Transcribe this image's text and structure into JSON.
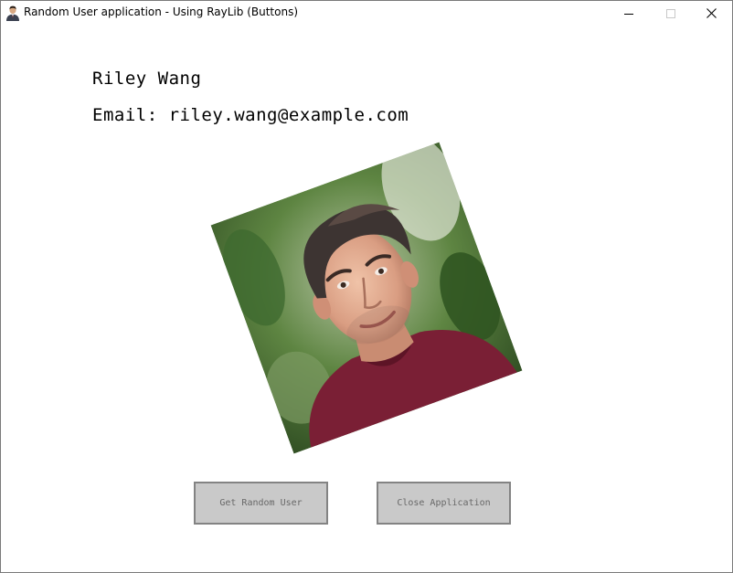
{
  "window": {
    "title": "Random User application - Using RayLib (Buttons)",
    "controls": {
      "minimize_icon": "minimize-icon",
      "maximize_icon": "maximize-icon",
      "close_icon": "close-icon"
    }
  },
  "user": {
    "name": "Riley Wang",
    "email": "Email: riley.wang@example.com",
    "photo_icon": "user-photo"
  },
  "buttons": {
    "random_label": "Get Random User",
    "close_label": "Close Application"
  },
  "colors": {
    "button_fill": "#c9c9c9",
    "button_border": "#838383",
    "button_text": "#686868"
  }
}
